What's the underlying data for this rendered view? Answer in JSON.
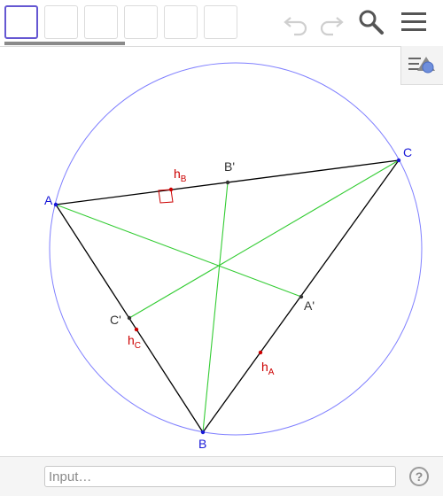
{
  "toolbar": {
    "tool_buttons": [
      "tool-move",
      "tool-2",
      "tool-3",
      "tool-4",
      "tool-5",
      "tool-6"
    ],
    "selected_tool": 0,
    "icons": {
      "undo": "undo-icon",
      "redo": "redo-icon",
      "search": "search-icon",
      "menu": "menu-icon"
    }
  },
  "style_bar": {
    "icon": "style-bar-icon"
  },
  "construction": {
    "points": {
      "A": {
        "label": "A"
      },
      "B": {
        "label": "B"
      },
      "C": {
        "label": "C"
      },
      "A1": {
        "label": "A'"
      },
      "B1": {
        "label": "B'"
      },
      "C1": {
        "label": "C'"
      }
    },
    "feet": {
      "hA": {
        "main": "h",
        "sub": "A"
      },
      "hB": {
        "main": "h",
        "sub": "B"
      },
      "hC": {
        "main": "h",
        "sub": "C"
      }
    },
    "colors": {
      "circle": "#8080ff",
      "triangle": "#000000",
      "median": "#33cc33",
      "altitude_foot": "#cc0000",
      "vertex_label": "#1818d8",
      "midpoint_label": "#333333"
    }
  },
  "input_bar": {
    "placeholder": "Input…",
    "help_label": "?"
  }
}
